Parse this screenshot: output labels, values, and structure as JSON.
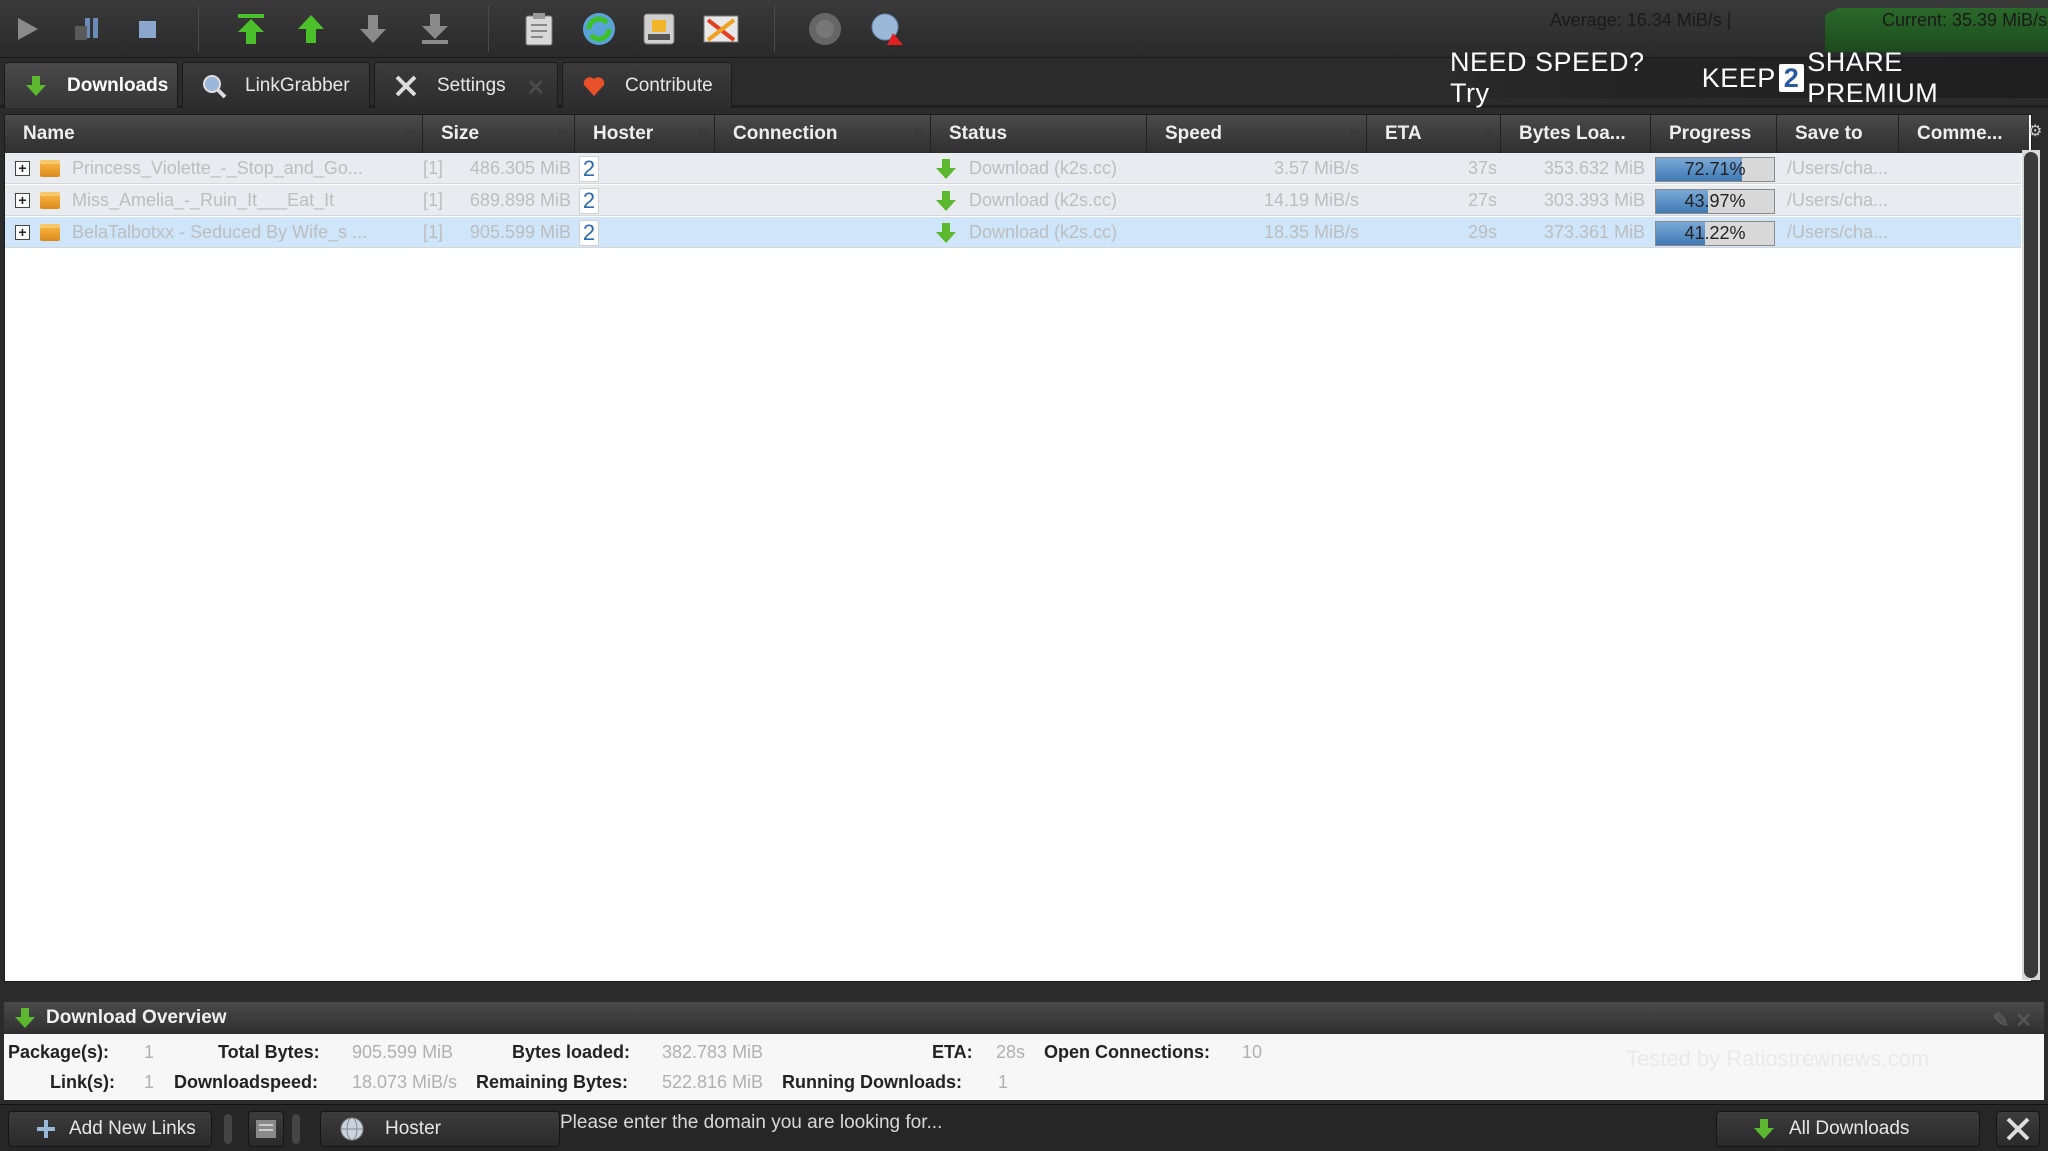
{
  "toolbar": {
    "icons": [
      "play-icon",
      "pause-icon",
      "stop-icon",
      "move-top-icon",
      "move-up-icon",
      "move-down-icon",
      "move-bottom-icon",
      "clipboard-icon",
      "reconnect-icon",
      "premium-icon",
      "clear-icon",
      "silent-mode-icon",
      "update-icon"
    ],
    "speed_average": "Average: 16.34 MiB/s |",
    "speed_current": "Current: 35.39 MiB/s"
  },
  "tabs": {
    "downloads": "Downloads",
    "linkgrabber": "LinkGrabber",
    "settings": "Settings",
    "settings_close": "✕",
    "contribute": "Contribute"
  },
  "banner": {
    "prefix": "NEED SPEED? Try",
    "keep": "KEEP",
    "two": "2",
    "share": "SHARE PREMIUM"
  },
  "table": {
    "columns": {
      "name": "Name",
      "size": "Size",
      "hoster": "Hoster",
      "connection": "Connection",
      "status": "Status",
      "speed": "Speed",
      "eta": "ETA",
      "bytes": "Bytes Loa...",
      "progress": "Progress",
      "saveto": "Save to",
      "comment": "Comme..."
    },
    "rows": [
      {
        "expander": "+",
        "name": "Princess_Violette_-_Stop_and_Go...",
        "count": "[1]",
        "size": "486.305 MiB",
        "hoster": "2",
        "status": "Download (k2s.cc)",
        "speed": "3.57 MiB/s",
        "eta": "37s",
        "bytes": "353.632 MiB",
        "progress_label": "72.71%",
        "progress": 0.7271,
        "saveto": "/Users/cha..."
      },
      {
        "expander": "+",
        "name": "Miss_Amelia_-_Ruin_It___Eat_It",
        "count": "[1]",
        "size": "689.898 MiB",
        "hoster": "2",
        "status": "Download (k2s.cc)",
        "speed": "14.19 MiB/s",
        "eta": "27s",
        "bytes": "303.393 MiB",
        "progress_label": "43.97%",
        "progress": 0.4397,
        "saveto": "/Users/cha..."
      },
      {
        "expander": "+",
        "name": "BelaTalbotxx - Seduced By Wife_s ...",
        "count": "[1]",
        "size": "905.599 MiB",
        "hoster": "2",
        "status": "Download (k2s.cc)",
        "speed": "18.35 MiB/s",
        "eta": "29s",
        "bytes": "373.361 MiB",
        "progress_label": "41.22%",
        "progress": 0.4122,
        "saveto": "/Users/cha..."
      }
    ]
  },
  "overview": {
    "title": "Download Overview",
    "packages_label": "Package(s):",
    "packages": "1",
    "total_bytes_label": "Total Bytes:",
    "total_bytes": "905.599 MiB",
    "bytes_loaded_label": "Bytes loaded:",
    "bytes_loaded": "382.783 MiB",
    "eta_label": "ETA:",
    "eta": "28s",
    "open_conn_label": "Open Connections:",
    "open_conn": "10",
    "links_label": "Link(s):",
    "links": "1",
    "dlspeed_label": "Downloadspeed:",
    "dlspeed": "18.073 MiB/s",
    "remaining_label": "Remaining Bytes:",
    "remaining": "522.816 MiB",
    "running_label": "Running Downloads:",
    "running": "1",
    "watermark": "Tested by Ratiostrewnews.com"
  },
  "bottom": {
    "add_links": "Add New Links",
    "hoster_select": "Hoster",
    "search_placeholder": "Please enter the domain you are looking for...",
    "all_downloads": "All Downloads"
  },
  "colors": {
    "accent_green": "#5cb82e",
    "selection_blue": "#cfe6fa",
    "progress_blue": "#3f79b5"
  }
}
